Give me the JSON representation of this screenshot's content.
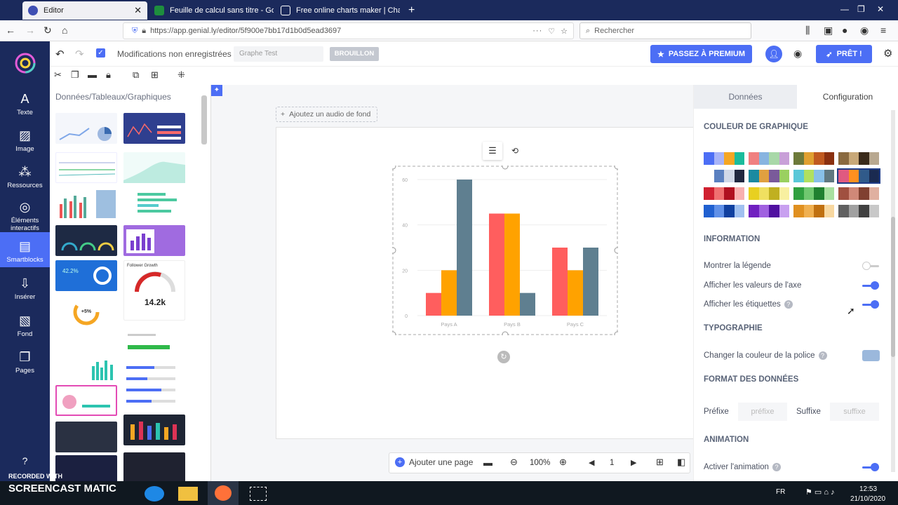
{
  "browser": {
    "tabs": [
      {
        "label": "Editor",
        "color": "#ffffff"
      },
      {
        "label": "Feuille de calcul sans titre - Go",
        "color": "#1e8e3e"
      },
      {
        "label": "Free online charts maker | Cha",
        "color": "#e8e8e8"
      }
    ],
    "url": "https://app.genial.ly/editor/5f900e7bb17d1b0d5ead3697",
    "search_placeholder": "Rechercher"
  },
  "sidebar": {
    "items": [
      {
        "label": "Texte",
        "icon": "text-icon"
      },
      {
        "label": "Image",
        "icon": "image-icon"
      },
      {
        "label": "Ressources",
        "icon": "resources-icon"
      },
      {
        "label": "Éléments interactifs",
        "icon": "interactive-icon"
      },
      {
        "label": "Smartblocks",
        "icon": "smartblocks-icon"
      },
      {
        "label": "Insérer",
        "icon": "insert-icon"
      },
      {
        "label": "Fond",
        "icon": "background-icon"
      },
      {
        "label": "Pages",
        "icon": "pages-icon"
      }
    ]
  },
  "topbar": {
    "status": "Modifications non enregistrées",
    "title_placeholder": "Graphe Test",
    "draft_label": "BROUILLON",
    "premium_label": "PASSEZ À PREMIUM",
    "ready_label": "PRÊT !"
  },
  "leftpanel": {
    "section_title": "Données/Tableaux/Graphiques",
    "gauge_value": "14.2k",
    "growth_title": "Follower Growth",
    "percent_value": "+5%"
  },
  "canvas": {
    "audio_label": "Ajoutez un audio de fond"
  },
  "chart_data": {
    "type": "bar",
    "categories": [
      "Pays A",
      "Pays B",
      "Pays C"
    ],
    "series": [
      {
        "values": [
          10,
          45,
          30
        ],
        "color": "#ff5e5e"
      },
      {
        "values": [
          20,
          45,
          20
        ],
        "color": "#ffa200"
      },
      {
        "values": [
          60,
          10,
          30
        ],
        "color": "#5f7f90"
      }
    ],
    "yticks": [
      0,
      20,
      40,
      60
    ],
    "ylim": [
      0,
      60
    ]
  },
  "rightpanel": {
    "tabs": [
      "Données",
      "Configuration"
    ],
    "color_section": "COULEUR DE GRAPHIQUE",
    "info_section": "INFORMATION",
    "show_legend": "Montrer la légende",
    "show_axis_values": "Afficher les valeurs de l'axe",
    "show_labels": "Afficher les étiquettes",
    "typography_section": "TYPOGRAPHIE",
    "font_color": "Changer la couleur de la police",
    "font_color_value": "#9bb8dc",
    "format_section": "FORMAT DES DONNÉES",
    "prefix_label": "Préfixe",
    "prefix_placeholder": "préfixe",
    "suffix_label": "Suffixe",
    "suffix_placeholder": "suffixe",
    "animation_section": "ANIMATION",
    "enable_animation": "Activer l'animation",
    "toggles": {
      "legend": false,
      "axis_values": true,
      "labels": true,
      "animation": true
    },
    "palettes": [
      [
        "#4c6ef5",
        "#a8b4f8",
        "#f5a623",
        "#1abc9c"
      ],
      [
        "#f08080",
        "#88b4e0",
        "#a8d8a8",
        "#c8a0d8"
      ],
      [
        "#6d7a3a",
        "#e0a030",
        "#c05a20",
        "#8a3010"
      ],
      [
        "#8a6a40",
        "#c8a878",
        "#3a2a1a",
        "#b8a890"
      ],
      [
        "#ffffff",
        "#5a80c0",
        "#d0d8e8",
        "#202840"
      ],
      [
        "#1a8aa0",
        "#e0a040",
        "#7a5a9a",
        "#9ad060"
      ],
      [
        "#5ac8d8",
        "#b0e060",
        "#88c0e8",
        "#607880"
      ],
      [
        "#e05a80",
        "#ff9020",
        "#305a8a",
        "#1a2a50"
      ],
      [
        "#d02030",
        "#f07070",
        "#b01020",
        "#f8b0b0"
      ],
      [
        "#e8d020",
        "#f0e060",
        "#c0b020",
        "#f8f0a0"
      ],
      [
        "#30a040",
        "#70c870",
        "#208030",
        "#a8e0a0"
      ],
      [
        "#a05040",
        "#d08878",
        "#804030",
        "#e0b0a0"
      ],
      [
        "#2060d0",
        "#6090e8",
        "#1040a0",
        "#a0c0f0"
      ],
      [
        "#7020c0",
        "#a060e0",
        "#5010a0",
        "#c8a0f0"
      ],
      [
        "#e09020",
        "#f0b050",
        "#c07010",
        "#f8d8a0"
      ],
      [
        "#606060",
        "#a0a0a0",
        "#404040",
        "#c8c8c8"
      ]
    ]
  },
  "bottombar": {
    "add_page": "Ajouter une page",
    "zoom": "100%",
    "page_number": "1"
  },
  "taskbar": {
    "recorded": "RECORDED WITH",
    "brand": "SCREENCAST MATIC",
    "lang": "FR",
    "time": "12:53",
    "date": "21/10/2020"
  }
}
